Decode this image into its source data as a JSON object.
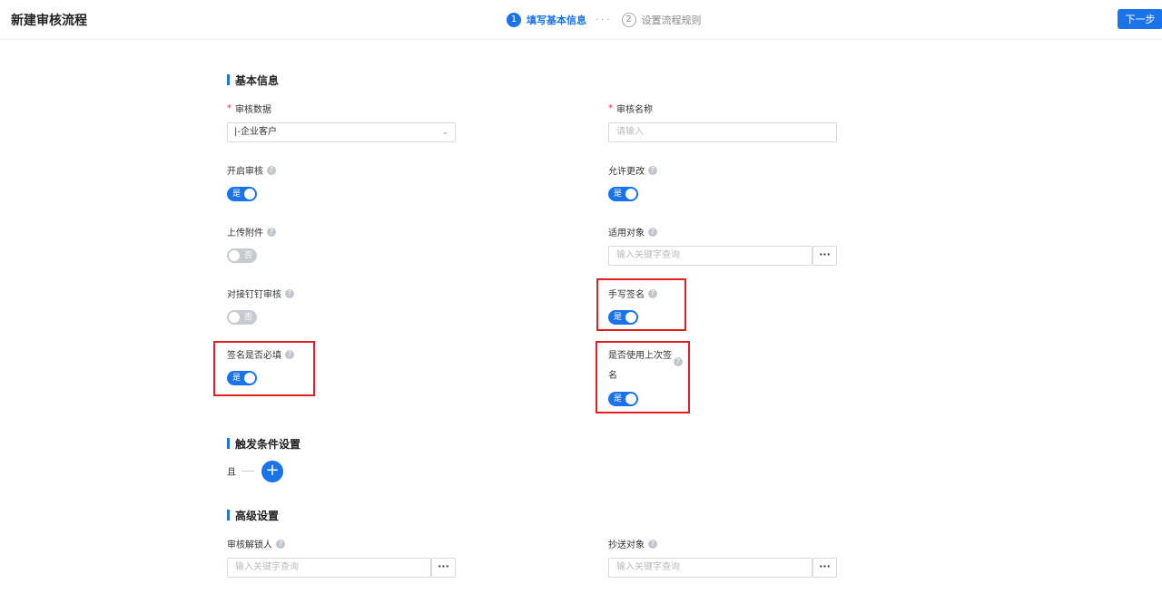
{
  "header": {
    "title": "新建审核流程",
    "next_label": "下一步",
    "steps": [
      {
        "num": "1",
        "label": "填写基本信息"
      },
      {
        "num": "2",
        "label": "设置流程规则"
      }
    ],
    "step_dots": "···"
  },
  "basic": {
    "section_title": "基本信息",
    "audit_data_label": "审核数据",
    "audit_data_value": "|-企业客户",
    "audit_name_label": "审核名称",
    "audit_name_placeholder": "请输入",
    "enable_label": "开启审核",
    "enable_value": "是",
    "allow_change_label": "允许更改",
    "allow_change_value": "是",
    "upload_label": "上传附件",
    "upload_value": "否",
    "target_label": "适用对象",
    "target_placeholder": "输入关键字查询",
    "dingding_label": "对接钉钉审核",
    "dingding_value": "否",
    "handwrite_label": "手写签名",
    "handwrite_value": "是",
    "sign_required_label": "签名是否必填",
    "sign_required_value": "是",
    "use_last_label_line1": "是否使用上次签",
    "use_last_label_line2": "名",
    "use_last_value": "是"
  },
  "trigger": {
    "section_title": "触发条件设置",
    "and_label": "且",
    "add_symbol": "+"
  },
  "advanced": {
    "section_title": "高级设置",
    "unlock_label": "审核解锁人",
    "unlock_placeholder": "输入关键字查询",
    "cc_label": "抄送对象",
    "cc_placeholder": "输入关键字查询",
    "more_symbol": "···"
  },
  "help_symbol": "?",
  "colors": {
    "accent": "#1a73e8",
    "highlight_box": "#e02020"
  }
}
